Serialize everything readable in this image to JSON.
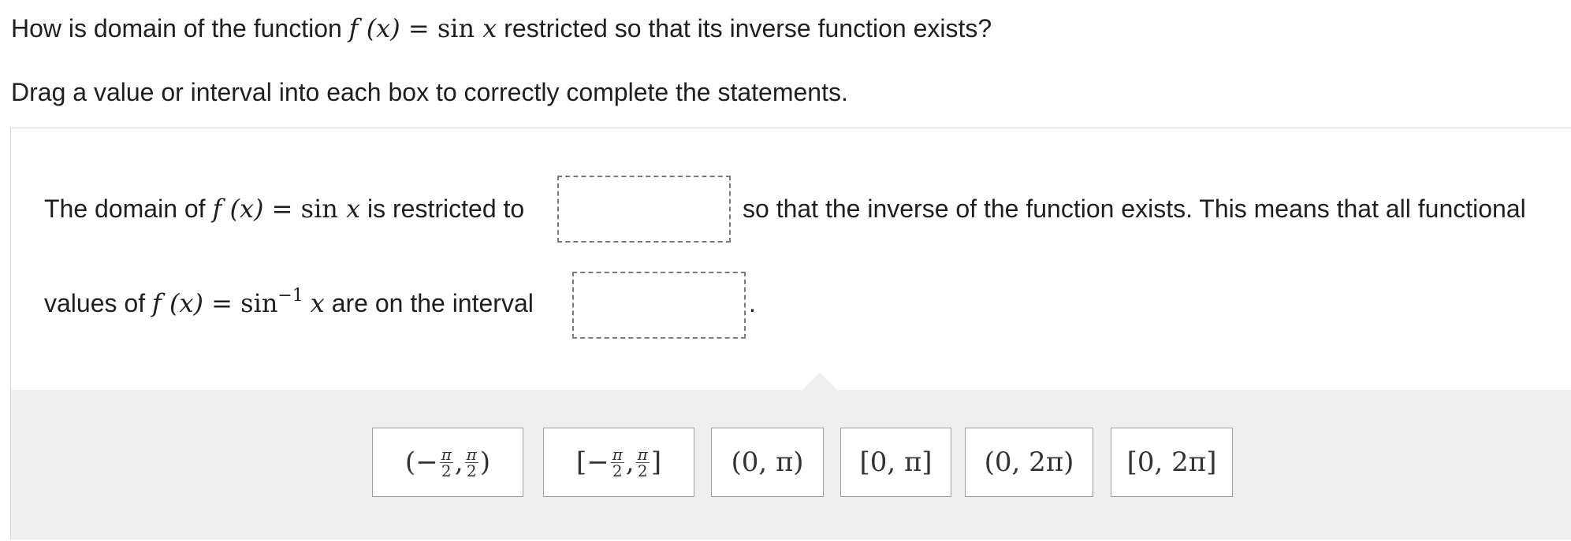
{
  "question": {
    "prefix": "How is domain of the function",
    "fx": "f (x)",
    "eq": " = sin ",
    "var": "x",
    "suffix": "restricted so that its inverse function exists?"
  },
  "instructions": "Drag a value or interval into each box to correctly complete the statements.",
  "statement1": {
    "prefix": "The domain of",
    "fx": "f (x)",
    "eq": " = sin ",
    "var": "x",
    "mid": "is restricted to",
    "suffix": "so that the inverse of the function exists. This means that all functional"
  },
  "statement2": {
    "prefix": "values of",
    "fx": "f (x)",
    "eq": " = sin",
    "sup": "−1",
    "var": "x",
    "mid": "are on the interval",
    "suffix": "."
  },
  "tiles": [
    {
      "open": "(",
      "left": "−",
      "pi": "π",
      "two": "2",
      "comma": ", ",
      "close": ")"
    },
    {
      "open": "[",
      "left": "−",
      "pi": "π",
      "two": "2",
      "comma": ", ",
      "close": "]"
    },
    {
      "text": "(0, π)"
    },
    {
      "text": "[0, π]"
    },
    {
      "text": "(0, 2π)"
    },
    {
      "text": "[0, 2π]"
    }
  ]
}
